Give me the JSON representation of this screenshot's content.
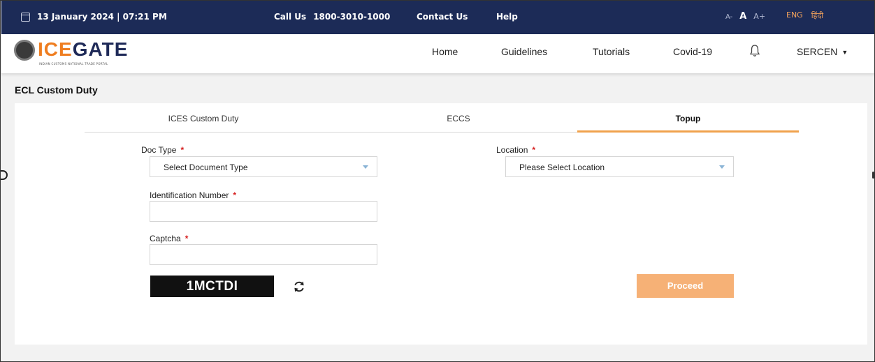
{
  "topbar": {
    "datetime": "13 January 2024 | 07:21 PM",
    "call_label": "Call Us",
    "call_number": "1800-3010-1000",
    "contact": "Contact Us",
    "help": "Help",
    "font_smaller": "A-",
    "font_normal": "A",
    "font_larger": "A+",
    "lang_en": "ENG",
    "lang_hi": "हिंदी",
    "bg_color": "#1c2b57",
    "accent_color": "#f3a35c"
  },
  "brand": {
    "name_accent": "ICE",
    "name_rest": "GATE",
    "tagline": "INDIAN CUSTOMS NATIONAL TRADE PORTAL"
  },
  "nav": {
    "items": [
      "Home",
      "Guidelines",
      "Tutorials",
      "Covid-19"
    ],
    "user": "SERCEN",
    "bell_icon": "bell-icon"
  },
  "page": {
    "title": "ECL Custom Duty"
  },
  "tabs": {
    "items": [
      "ICES Custom Duty",
      "ECCS",
      "Topup"
    ],
    "active": "Topup",
    "active_color": "#f0a24c"
  },
  "form": {
    "doc_type_label": "Doc Type",
    "doc_type_value": "Select Document Type",
    "location_label": "Location",
    "location_value": "Please Select Location",
    "id_label": "Identification Number",
    "id_value": "",
    "captcha_label": "Captcha",
    "captcha_value": "",
    "captcha_image_text": "1MCTDI",
    "required_marker": "*",
    "proceed_label": "Proceed",
    "proceed_color": "#f6b176"
  }
}
